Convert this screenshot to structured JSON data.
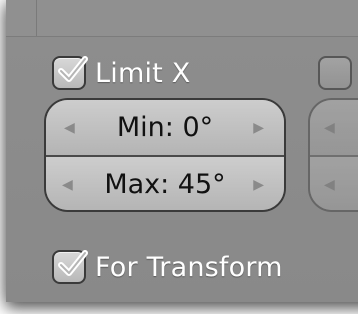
{
  "constraint": {
    "limit_x": {
      "label": "Limit X",
      "checked": true
    },
    "min": {
      "label": "Min: 0°",
      "left_arrow": "◀",
      "right_arrow": "▶"
    },
    "max": {
      "label": "Max: 45°",
      "left_arrow": "◀",
      "right_arrow": "▶"
    },
    "for_transform": {
      "label": "For Transform",
      "checked": true
    }
  },
  "right_column": {
    "left_arrow": "◀"
  },
  "icons": {
    "checkmark": "checkmark-icon",
    "arrow_left": "arrow-left-icon",
    "arrow_right": "arrow-right-icon"
  },
  "colors": {
    "panel": "#8c8c8c",
    "field": "#c4c4c4",
    "border": "#3a3a3a",
    "label_text": "#ffffff",
    "value_text": "#111111"
  }
}
